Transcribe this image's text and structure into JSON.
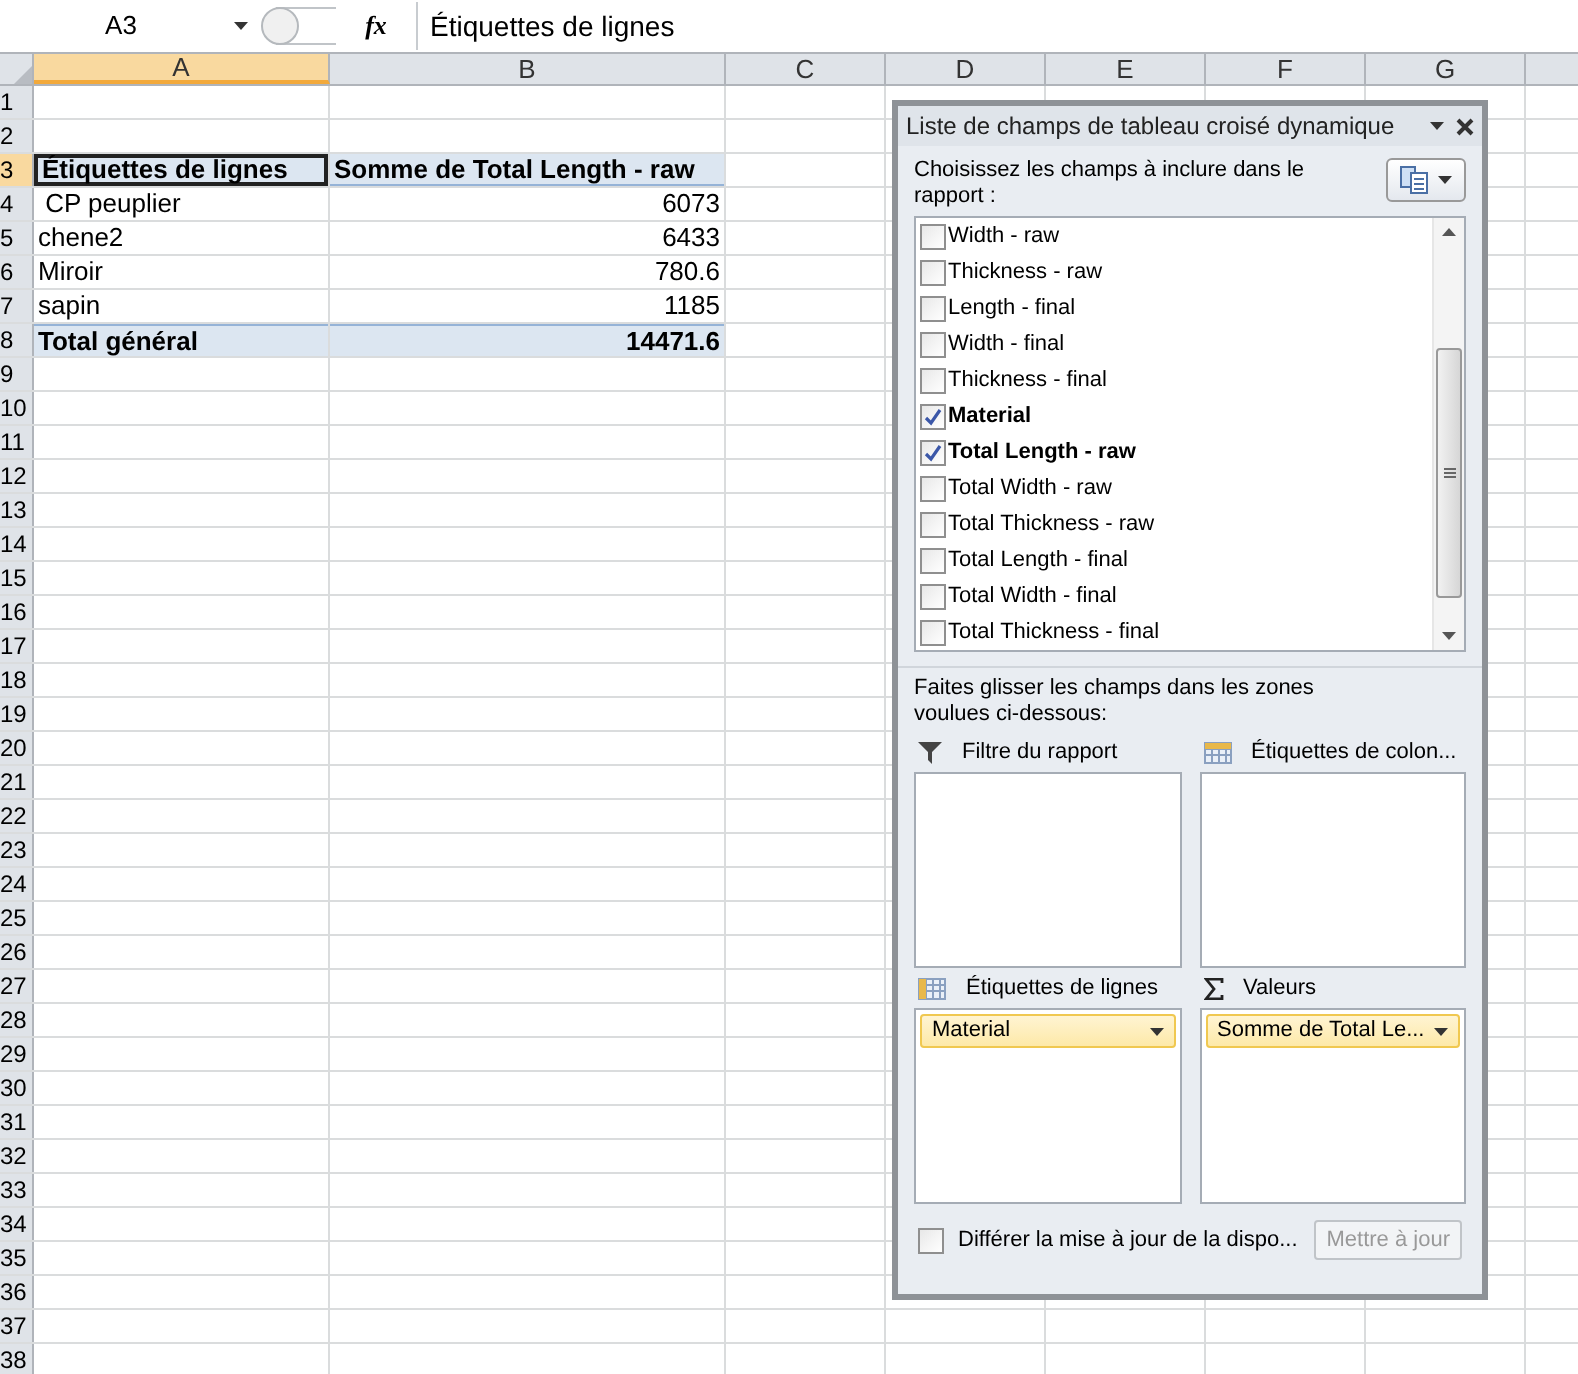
{
  "formula_bar": {
    "name_box": "A3",
    "function_label": "fx",
    "formula": "Étiquettes de lignes"
  },
  "columns": [
    {
      "label": "A",
      "selected": true
    },
    {
      "label": "B",
      "selected": false
    },
    {
      "label": "C",
      "selected": false
    },
    {
      "label": "D",
      "selected": false
    },
    {
      "label": "E",
      "selected": false
    },
    {
      "label": "F",
      "selected": false
    },
    {
      "label": "G",
      "selected": false
    }
  ],
  "rows": [
    {
      "label": "1",
      "selected": false
    },
    {
      "label": "2",
      "selected": false
    },
    {
      "label": "3",
      "selected": true
    },
    {
      "label": "4",
      "selected": false
    },
    {
      "label": "5",
      "selected": false
    },
    {
      "label": "6",
      "selected": false
    },
    {
      "label": "7",
      "selected": false
    },
    {
      "label": "8",
      "selected": false
    },
    {
      "label": "9",
      "selected": false
    },
    {
      "label": "10",
      "selected": false
    },
    {
      "label": "11",
      "selected": false
    },
    {
      "label": "12",
      "selected": false
    },
    {
      "label": "13",
      "selected": false
    },
    {
      "label": "14",
      "selected": false
    },
    {
      "label": "15",
      "selected": false
    },
    {
      "label": "16",
      "selected": false
    },
    {
      "label": "17",
      "selected": false
    },
    {
      "label": "18",
      "selected": false
    },
    {
      "label": "19",
      "selected": false
    },
    {
      "label": "20",
      "selected": false
    },
    {
      "label": "21",
      "selected": false
    },
    {
      "label": "22",
      "selected": false
    },
    {
      "label": "23",
      "selected": false
    },
    {
      "label": "24",
      "selected": false
    },
    {
      "label": "25",
      "selected": false
    },
    {
      "label": "26",
      "selected": false
    },
    {
      "label": "27",
      "selected": false
    },
    {
      "label": "28",
      "selected": false
    },
    {
      "label": "29",
      "selected": false
    },
    {
      "label": "30",
      "selected": false
    },
    {
      "label": "31",
      "selected": false
    },
    {
      "label": "32",
      "selected": false
    },
    {
      "label": "33",
      "selected": false
    },
    {
      "label": "34",
      "selected": false
    },
    {
      "label": "35",
      "selected": false
    },
    {
      "label": "36",
      "selected": false
    },
    {
      "label": "37",
      "selected": false
    },
    {
      "label": "38",
      "selected": false
    }
  ],
  "pivot_table": {
    "header": {
      "label": "Étiquettes de lignes",
      "value": "Somme de Total Length - raw"
    },
    "rows": [
      {
        "label": " CP peuplier",
        "value": "6073"
      },
      {
        "label": "chene2",
        "value": "6433"
      },
      {
        "label": "Miroir",
        "value": "780.6"
      },
      {
        "label": "sapin",
        "value": "1185"
      }
    ],
    "total": {
      "label": "Total général",
      "value": "14471.6"
    }
  },
  "field_list": {
    "title": "Liste de champs de tableau croisé dynamique",
    "instruction": "Choisissez les champs à inclure dans le rapport :",
    "fields": [
      {
        "label": "Width - raw",
        "checked": false
      },
      {
        "label": "Thickness - raw",
        "checked": false
      },
      {
        "label": "Length - final",
        "checked": false
      },
      {
        "label": "Width - final",
        "checked": false
      },
      {
        "label": "Thickness - final",
        "checked": false
      },
      {
        "label": "Material",
        "checked": true
      },
      {
        "label": "Total Length - raw",
        "checked": true
      },
      {
        "label": "Total Width - raw",
        "checked": false
      },
      {
        "label": "Total Thickness - raw",
        "checked": false
      },
      {
        "label": "Total Length - final",
        "checked": false
      },
      {
        "label": "Total Width - final",
        "checked": false
      },
      {
        "label": "Total Thickness - final",
        "checked": false
      }
    ],
    "areas_instruction": "Faites glisser les champs dans les zones voulues ci-dessous:",
    "areas": [
      {
        "kind": "filter",
        "label": "Filtre du rapport"
      },
      {
        "kind": "columns",
        "label": "Étiquettes de colon..."
      },
      {
        "kind": "rows",
        "label": "Étiquettes de lignes",
        "items": [
          "Material"
        ]
      },
      {
        "kind": "values",
        "label": "Valeurs",
        "items": [
          "Somme de Total Le..."
        ]
      }
    ],
    "defer": {
      "label": "Différer la mise à jour de la dispo...",
      "checked": false
    },
    "update_button": {
      "label": "Mettre à jour",
      "disabled": true
    }
  }
}
